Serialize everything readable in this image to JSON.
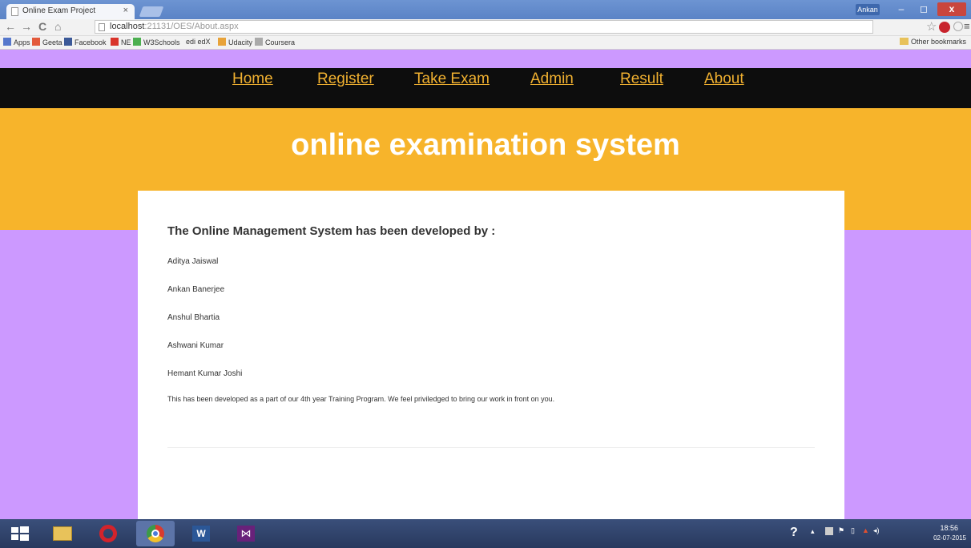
{
  "browser": {
    "tab_title": "Online Exam Project",
    "tab_close": "×",
    "user_badge": "Ankan",
    "window_buttons": {
      "minimize": "–",
      "maximize": "◻",
      "close": "x"
    },
    "nav": {
      "back": "←",
      "forward": "→",
      "reload": "C",
      "home": "⌂"
    },
    "url_host": "localhost",
    "url_path": ":21131/OES/About.aspx",
    "menu": "≡",
    "star": "☆",
    "bookmarks": [
      {
        "label": "Apps",
        "color": "#5577cc"
      },
      {
        "label": "Geeta",
        "color": "#e35a3c"
      },
      {
        "label": "Facebook",
        "color": "#3b5998"
      },
      {
        "label": "NE",
        "color": "#d9342b"
      },
      {
        "label": "W3Schools",
        "color": "#4caf50"
      },
      {
        "label": "edi edX",
        "color": "#999999"
      },
      {
        "label": "Udacity",
        "color": "#e8a33a"
      },
      {
        "label": "Coursera",
        "color": "#aaaaaa"
      }
    ],
    "other_bookmarks": "Other bookmarks"
  },
  "site": {
    "nav": [
      "Home",
      "Register",
      "Take Exam",
      "Admin",
      "Result",
      "About"
    ],
    "title": "online examination system",
    "heading": "The Online Management System has been developed by :",
    "developers": [
      "Aditya Jaiswal",
      "Ankan Banerjee",
      "Anshul Bhartia",
      "Ashwani Kumar",
      "Hemant Kumar Joshi"
    ],
    "note": "This has been developed as a part of our 4th year Training Program. We feel priviledged to bring our work in front on you."
  },
  "colors": {
    "nav_bg": "#0d0d0d",
    "nav_link": "#f0b030",
    "banner": "#f7b42b",
    "page_bg": "#cc99ff",
    "card": "#ffffff"
  },
  "taskbar": {
    "apps": [
      "windows-start-icon",
      "file-explorer-icon",
      "opera-icon",
      "chrome-icon",
      "word-icon",
      "visual-studio-icon"
    ],
    "time": "18:56",
    "date": "02-07-2015"
  }
}
